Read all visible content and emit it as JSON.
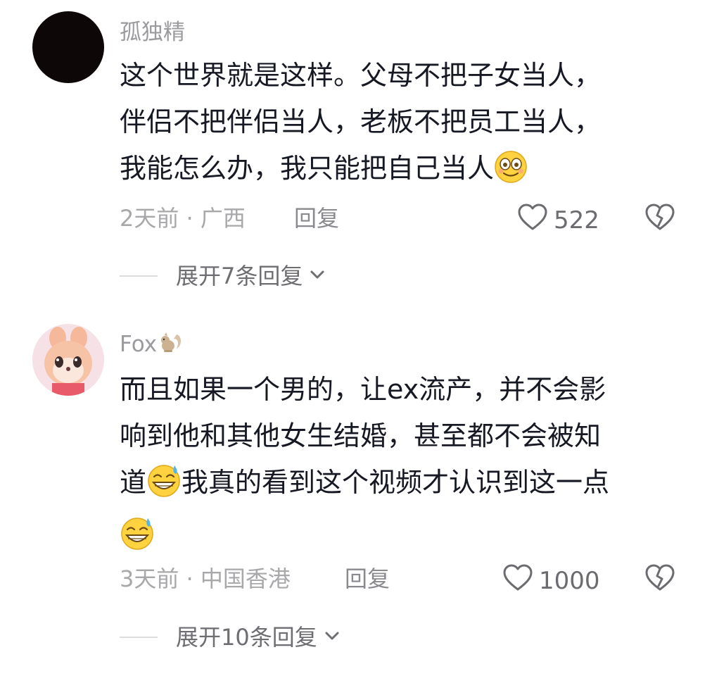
{
  "comments": [
    {
      "username": "孤独精",
      "lines": [
        "这个世界就是这样。父母不把子女当人，",
        "伴侣不把伴侣当人，老板不把员工当人，",
        "我能怎么办，我只能把自己当人"
      ],
      "meta": "2天前 · 广西",
      "reply_label": "回复",
      "likes": "522",
      "expand_label": "展开7条回复",
      "avatar_icon": "dark-circle-avatar",
      "emoji_icon": "dizzy-smile-emoji"
    },
    {
      "username": "Fox",
      "username_icon": "squirrel-emoji",
      "lines": [
        "而且如果一个男的，让ex流产，并不会影",
        "响到他和其他女生结婚，甚至都不会被知",
        "我真的看到这个视频才认识到这一点"
      ],
      "line3_prefix": "道",
      "meta": "3天前 · 中国香港",
      "reply_label": "回复",
      "likes": "1000",
      "expand_label": "展开10条回复",
      "avatar_icon": "pink-bunny-avatar",
      "emoji_icon": "grin-sweat-emoji"
    }
  ],
  "colors": {
    "text": "#161823",
    "secondary": "#a8a8ab",
    "username": "#9b9b9f"
  }
}
